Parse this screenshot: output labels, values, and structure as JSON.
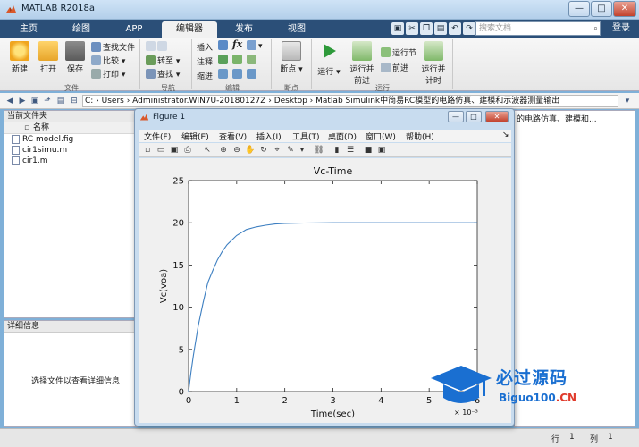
{
  "window": {
    "title": "MATLAB R2018a",
    "controls": {
      "minimize": "—",
      "maximize": "□",
      "close": "✕"
    }
  },
  "tabs": [
    {
      "label": "主页"
    },
    {
      "label": "绘图"
    },
    {
      "label": "APP"
    },
    {
      "label": "编辑器",
      "active": true
    },
    {
      "label": "发布"
    },
    {
      "label": "视图"
    }
  ],
  "search": {
    "placeholder": "搜索文档"
  },
  "login_label": "登录",
  "ribbon": {
    "file": {
      "new_label": "新建",
      "open_label": "打开",
      "save_label": "保存",
      "find_file": "查找文件",
      "compare": "比较",
      "print": "打印",
      "group": "文件"
    },
    "nav": {
      "goto": "转至",
      "find": "查找",
      "group": "导航"
    },
    "edit": {
      "insert": "插入",
      "comment": "注释",
      "indent": "缩进",
      "group": "编辑"
    },
    "breakpoints": {
      "label": "断点",
      "group": "断点"
    },
    "run": {
      "run": "运行",
      "run_advance_1": "运行并",
      "run_advance_2": "前进",
      "run_section": "运行节",
      "advance": "前进",
      "run_time_1": "运行并",
      "run_time_2": "计时",
      "group": "运行"
    }
  },
  "address": "C: › Users › Administrator.WIN7U-20180127Z › Desktop › Matlab Simulink中简易RC模型的电路仿真、建模和示波器测量输出",
  "current_folder": {
    "header": "当前文件夹",
    "column_name": "名称",
    "files": [
      "RC model.fig",
      "cir1simu.m",
      "cir1.m"
    ]
  },
  "details": {
    "header": "详细信息",
    "message": "选择文件以查看详细信息"
  },
  "right_truncated": "的电路仿真、建模和...",
  "status": {
    "row_label": "行",
    "row_value": "1",
    "col_label": "列",
    "col_value": "1"
  },
  "figure": {
    "title": "Figure 1",
    "menus": [
      "文件(F)",
      "编辑(E)",
      "查看(V)",
      "插入(I)",
      "工具(T)",
      "桌面(D)",
      "窗口(W)",
      "帮助(H)"
    ]
  },
  "chart_data": {
    "type": "line",
    "title": "Vc-Time",
    "xlabel": "Time(sec)",
    "ylabel": "Vc(voa)",
    "x_exponent": "× 10⁻³",
    "xlim": [
      0,
      6
    ],
    "ylim": [
      0,
      25
    ],
    "xticks": [
      0,
      1,
      2,
      3,
      4,
      5,
      6
    ],
    "yticks": [
      0,
      5,
      10,
      15,
      20,
      25
    ],
    "color": "#3d7fc1",
    "series": [
      {
        "x": [
          0,
          0.05,
          0.1,
          0.2,
          0.3,
          0.4,
          0.5,
          0.6,
          0.7,
          0.8,
          1.0,
          1.2,
          1.4,
          1.6,
          1.8,
          2.0,
          2.4,
          3.0,
          4.0,
          5.0,
          6.0
        ],
        "y": [
          0,
          2.3,
          4.3,
          7.8,
          10.5,
          12.9,
          14.3,
          15.6,
          16.6,
          17.4,
          18.5,
          19.2,
          19.5,
          19.7,
          19.85,
          19.92,
          19.97,
          20.0,
          20.0,
          20.0,
          20.0
        ]
      }
    ]
  },
  "watermark": {
    "cn": "必过源码",
    "en_main": "Biguo100",
    "en_suffix": ".CN"
  }
}
